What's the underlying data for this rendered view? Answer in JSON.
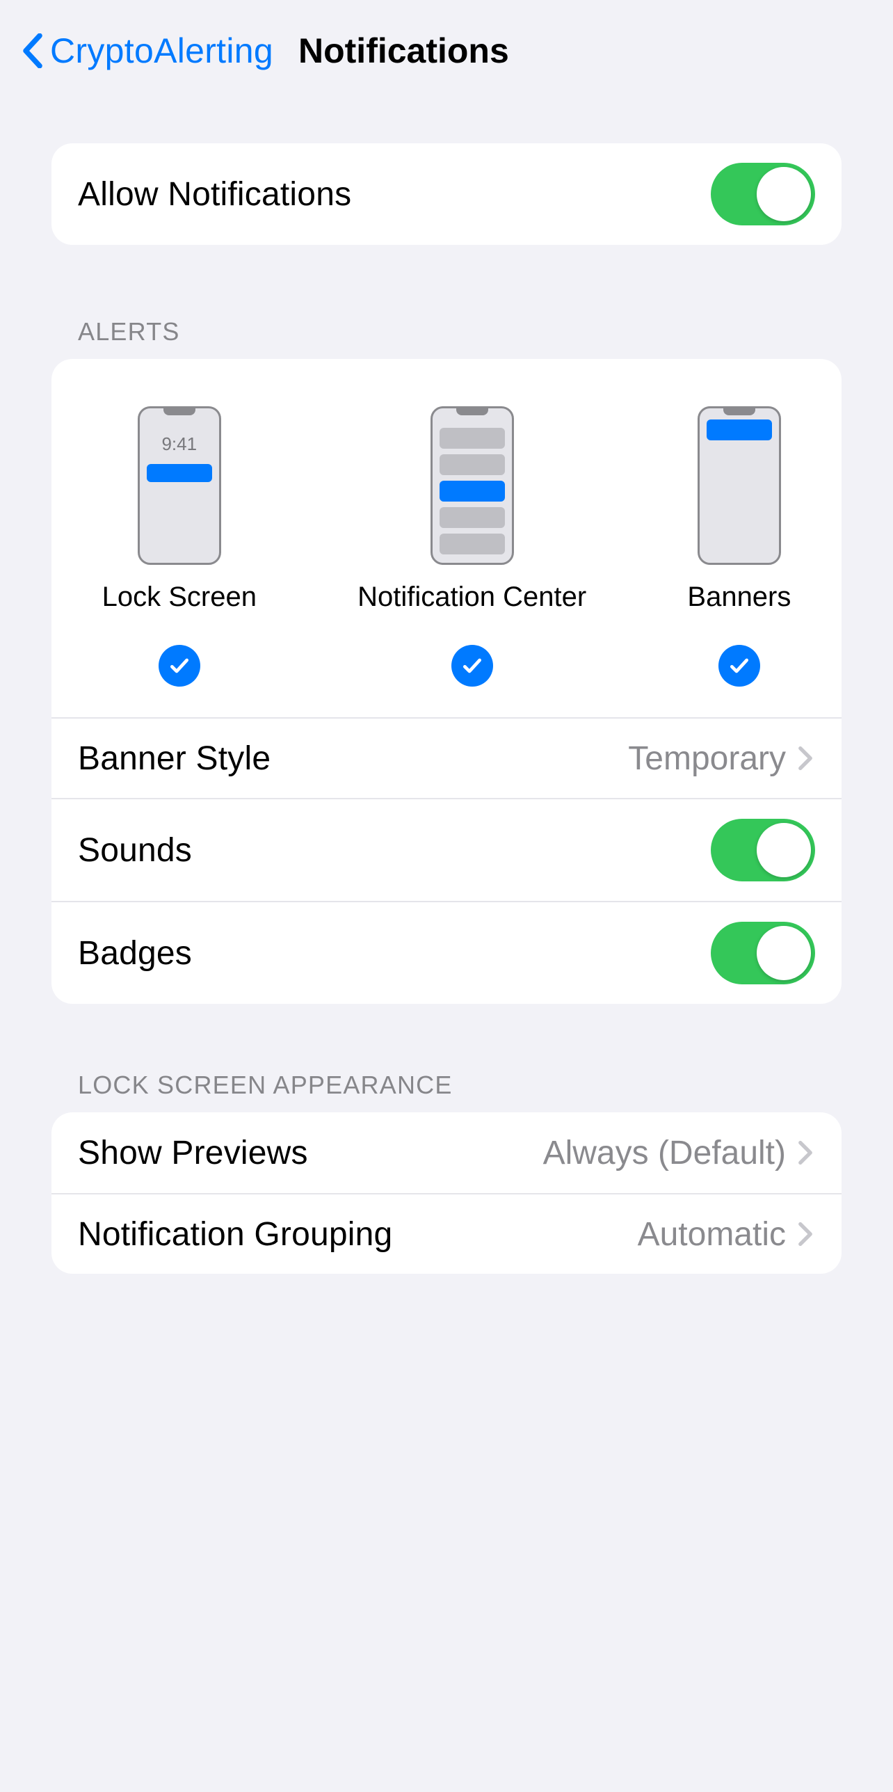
{
  "nav": {
    "back_label": "CryptoAlerting",
    "title": "Notifications"
  },
  "allow_notifications": {
    "label": "Allow Notifications",
    "on": true
  },
  "alerts_section": {
    "header": "ALERTS",
    "lock_screen": {
      "label": "Lock Screen",
      "checked": true,
      "time": "9:41"
    },
    "notification_center": {
      "label": "Notification Center",
      "checked": true
    },
    "banners": {
      "label": "Banners",
      "checked": true
    },
    "banner_style": {
      "label": "Banner Style",
      "value": "Temporary"
    },
    "sounds": {
      "label": "Sounds",
      "on": true
    },
    "badges": {
      "label": "Badges",
      "on": true
    }
  },
  "lock_screen_section": {
    "header": "LOCK SCREEN APPEARANCE",
    "show_previews": {
      "label": "Show Previews",
      "value": "Always (Default)"
    },
    "grouping": {
      "label": "Notification Grouping",
      "value": "Automatic"
    }
  }
}
